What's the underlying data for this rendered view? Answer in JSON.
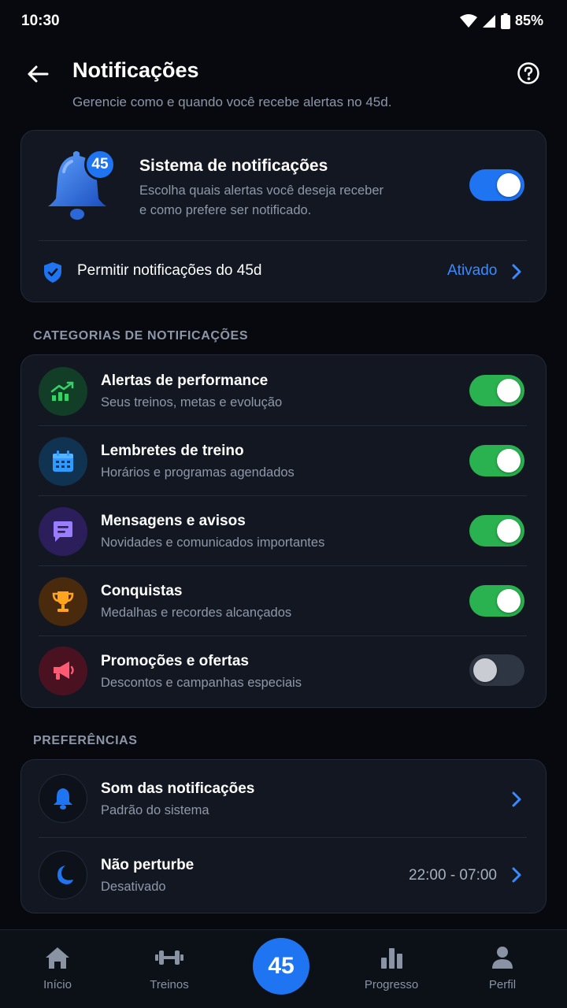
{
  "status_bar": {
    "time": "10:30",
    "battery": "85%"
  },
  "header": {
    "title": "Notificações",
    "subtitle": "Gerencie como e quando você recebe alertas no 45d."
  },
  "system_card": {
    "badge": "45",
    "title": "Sistema de notificações",
    "description_line1": "Escolha quais alertas você deseja receber",
    "description_line2": "e como prefere ser notificado.",
    "enabled": true,
    "permission_label": "Permitir notificações do 45d",
    "permission_status": "Ativado"
  },
  "categories": {
    "section_title": "CATEGORIAS DE NOTIFICAÇÕES",
    "items": [
      {
        "title": "Alertas de performance",
        "subtitle": "Seus treinos, metas e evolução",
        "icon": "trend-up-icon",
        "enabled": true
      },
      {
        "title": "Lembretes de treino",
        "subtitle": "Horários e programas agendados",
        "icon": "calendar-icon",
        "enabled": true
      },
      {
        "title": "Mensagens e avisos",
        "subtitle": "Novidades e comunicados importantes",
        "icon": "message-icon",
        "enabled": true
      },
      {
        "title": "Conquistas",
        "subtitle": "Medalhas e recordes alcançados",
        "icon": "trophy-icon",
        "enabled": true
      },
      {
        "title": "Promoções e ofertas",
        "subtitle": "Descontos e campanhas especiais",
        "icon": "megaphone-icon",
        "enabled": false
      }
    ]
  },
  "preferences": {
    "section_title": "PREFERÊNCIAS",
    "sound": {
      "title": "Som das notificações",
      "subtitle": "Padrão do sistema"
    },
    "dnd": {
      "title": "Não perturbe",
      "subtitle": "Desativado",
      "value": "22:00 - 07:00"
    }
  },
  "bottom_nav": {
    "home": "Início",
    "workouts": "Treinos",
    "center": "45",
    "progress": "Progresso",
    "profile": "Perfil"
  },
  "colors": {
    "accent_blue": "#1f74f2",
    "toggle_green": "#29b24f",
    "background": "#07090e",
    "card": "#121722"
  }
}
